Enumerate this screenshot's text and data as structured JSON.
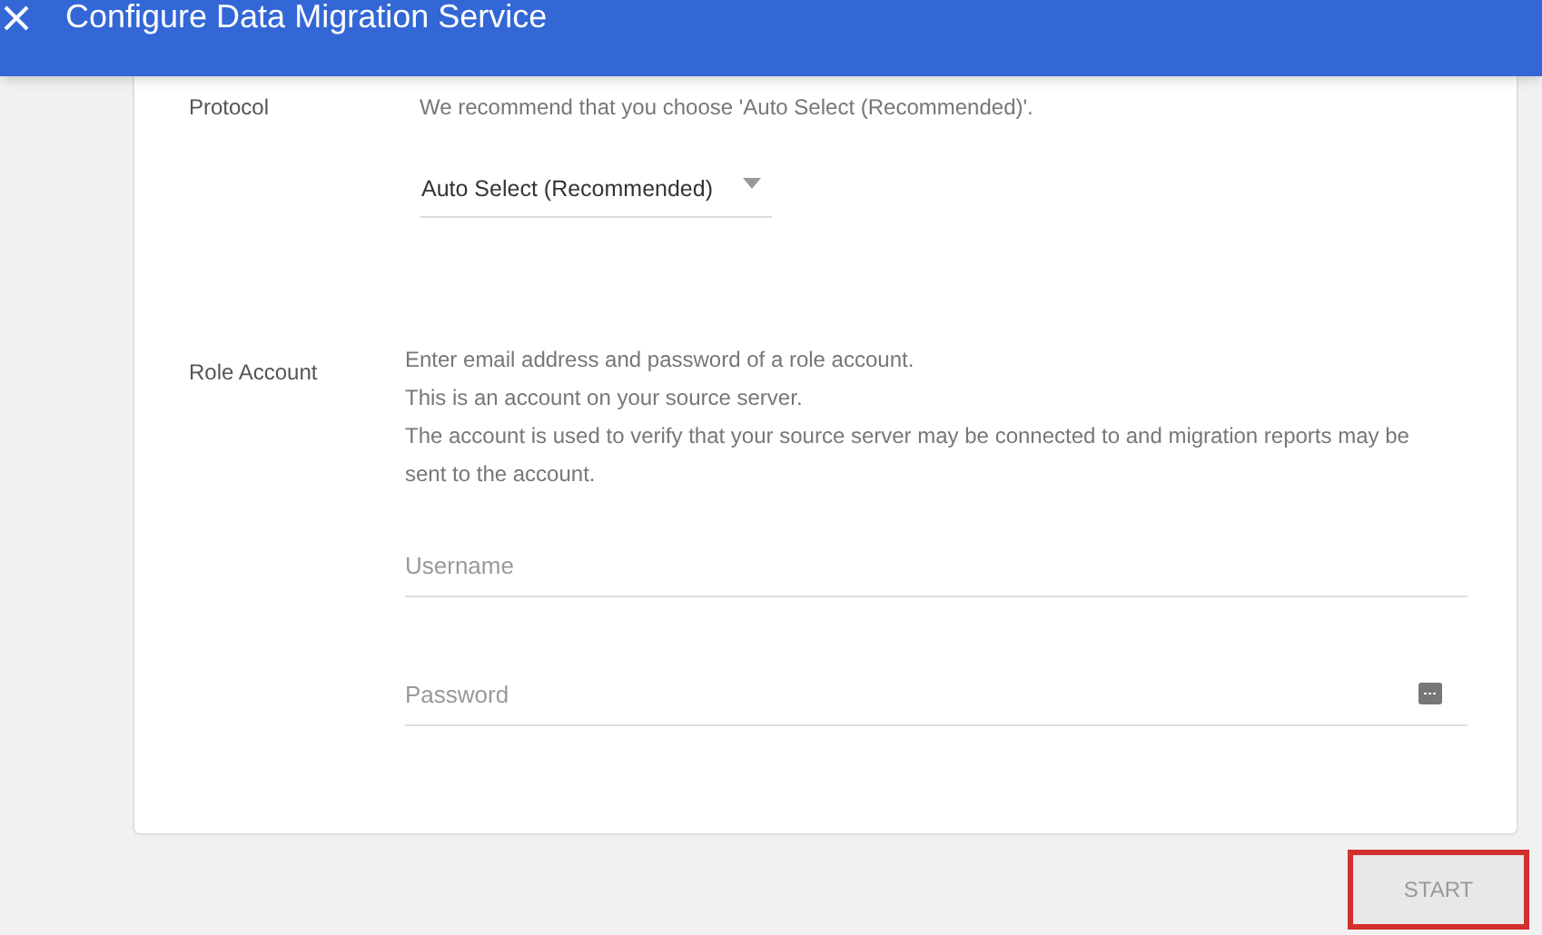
{
  "header": {
    "title": "Configure Data Migration Service"
  },
  "protocol": {
    "label": "Protocol",
    "description": "We recommend that you choose 'Auto Select (Recommended)'.",
    "dropdown": {
      "value": "Auto Select (Recommended)"
    }
  },
  "role_account": {
    "label": "Role Account",
    "description": [
      "Enter email address and password of a role account.",
      "This is an account on your source server.",
      "The account is used to verify that your source server may be connected to and migration reports may be sent to the account."
    ],
    "fields": [
      {
        "kind": "text",
        "placeholder": "Username"
      },
      {
        "kind": "password",
        "placeholder": "Password"
      }
    ]
  },
  "start_button": {
    "label": "START",
    "disabled": true,
    "highlighted": true
  }
}
